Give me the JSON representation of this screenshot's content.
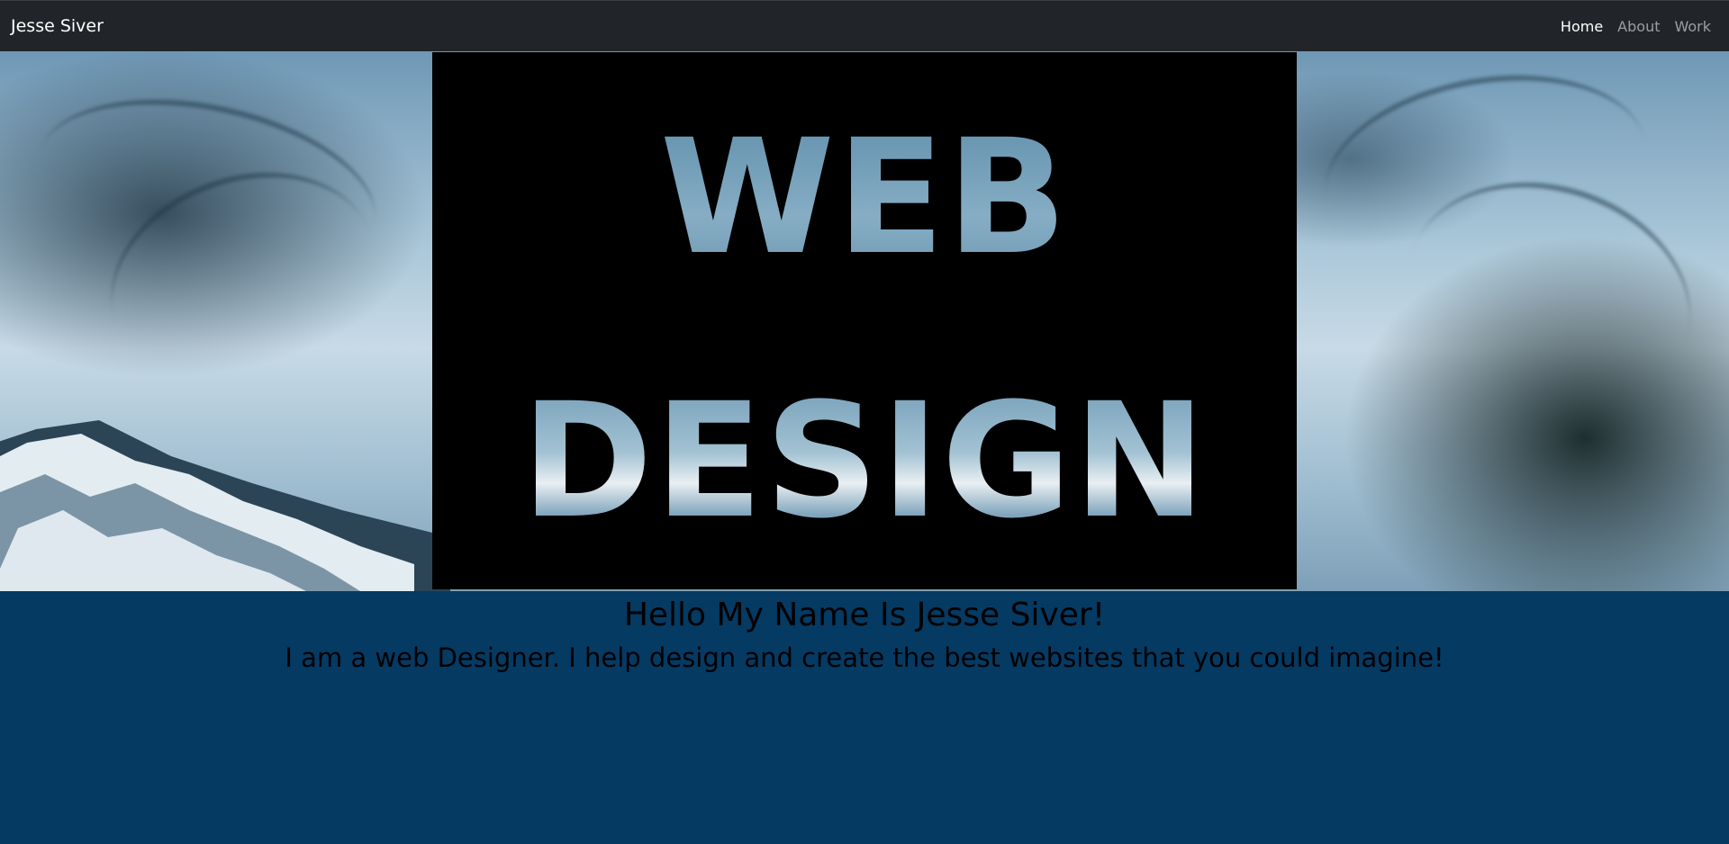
{
  "navbar": {
    "brand": "Jesse Siver",
    "links": [
      {
        "label": "Home",
        "active": true
      },
      {
        "label": "About",
        "active": false
      },
      {
        "label": "Work",
        "active": false
      }
    ]
  },
  "hero": {
    "line1": "WEB",
    "line2": "DESIGN"
  },
  "intro": {
    "title": "Hello My Name Is Jesse Siver!",
    "subtitle": "I am a web Designer. I help design and create the best websites that you could imagine!"
  },
  "colors": {
    "navbar_bg": "#212529",
    "page_bg": "#053a63",
    "hero_box": "#000000"
  }
}
